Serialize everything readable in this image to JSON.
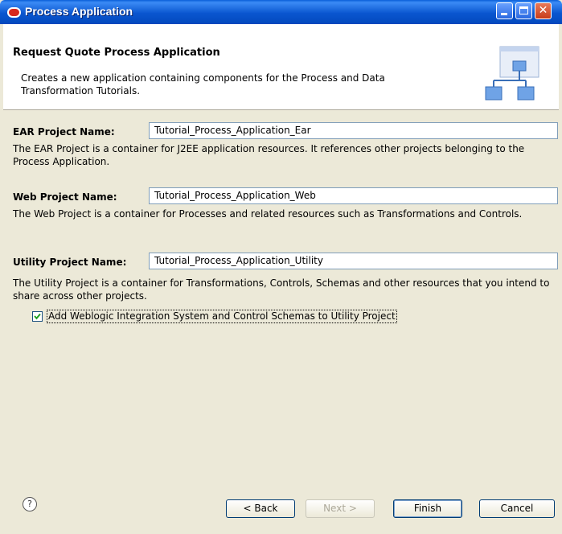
{
  "window": {
    "title": "Process Application"
  },
  "header": {
    "title": "Request Quote Process Application",
    "description": "Creates a new application containing components for the Process and Data Transformation Tutorials."
  },
  "fields": {
    "ear": {
      "label": "EAR Project Name:",
      "value": "Tutorial_Process_Application_Ear",
      "description": "The EAR Project is a container for J2EE application resources.  It references other projects belonging to the Process Application."
    },
    "web": {
      "label": "Web Project Name:",
      "value": "Tutorial_Process_Application_Web",
      "description": "The Web Project is a container for Processes and related resources such as Transformations and Controls."
    },
    "utility": {
      "label": "Utility Project Name:",
      "value": "Tutorial_Process_Application_Utility",
      "description": "The Utility Project is a container for Transformations, Controls, Schemas and other resources that you intend to share across other projects."
    }
  },
  "checkbox": {
    "label": "Add Weblogic Integration System and Control Schemas to Utility Project",
    "checked": true
  },
  "footer": {
    "help": "?",
    "back": "< Back",
    "next": "Next >",
    "finish": "Finish",
    "cancel": "Cancel"
  }
}
